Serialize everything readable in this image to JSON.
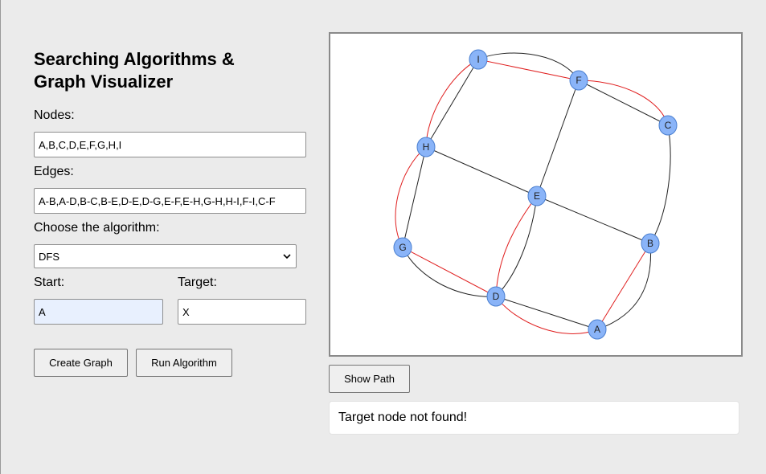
{
  "title": "Searching Algorithms & Graph Visualizer",
  "form": {
    "nodes_label": "Nodes:",
    "nodes_value": "A,B,C,D,E,F,G,H,I",
    "edges_label": "Edges:",
    "edges_value": "A-B,A-D,B-C,B-E,D-E,D-G,E-F,E-H,G-H,H-I,F-I,C-F",
    "algorithm_label": "Choose the algorithm:",
    "algorithm_value": "DFS",
    "start_label": "Start:",
    "start_value": "A",
    "target_label": "Target:",
    "target_value": "X"
  },
  "buttons": {
    "create_graph": "Create Graph",
    "run_algorithm": "Run Algorithm",
    "show_path": "Show Path"
  },
  "graph": {
    "nodes": [
      "I",
      "F",
      "C",
      "H",
      "E",
      "G",
      "B",
      "D",
      "A"
    ],
    "edges": [
      "A-B",
      "A-D",
      "B-C",
      "B-E",
      "D-E",
      "D-G",
      "E-F",
      "E-H",
      "G-H",
      "H-I",
      "F-I",
      "C-F"
    ],
    "traversal_edges": [
      "A-B",
      "A-D",
      "B-C",
      "D-E",
      "D-G",
      "G-H",
      "H-I",
      "F-I",
      "C-F"
    ],
    "node_fill": "#8ab4f8",
    "edge_color": "#222222",
    "traversal_color": "#e02020"
  },
  "status_message": "Target node not found!"
}
